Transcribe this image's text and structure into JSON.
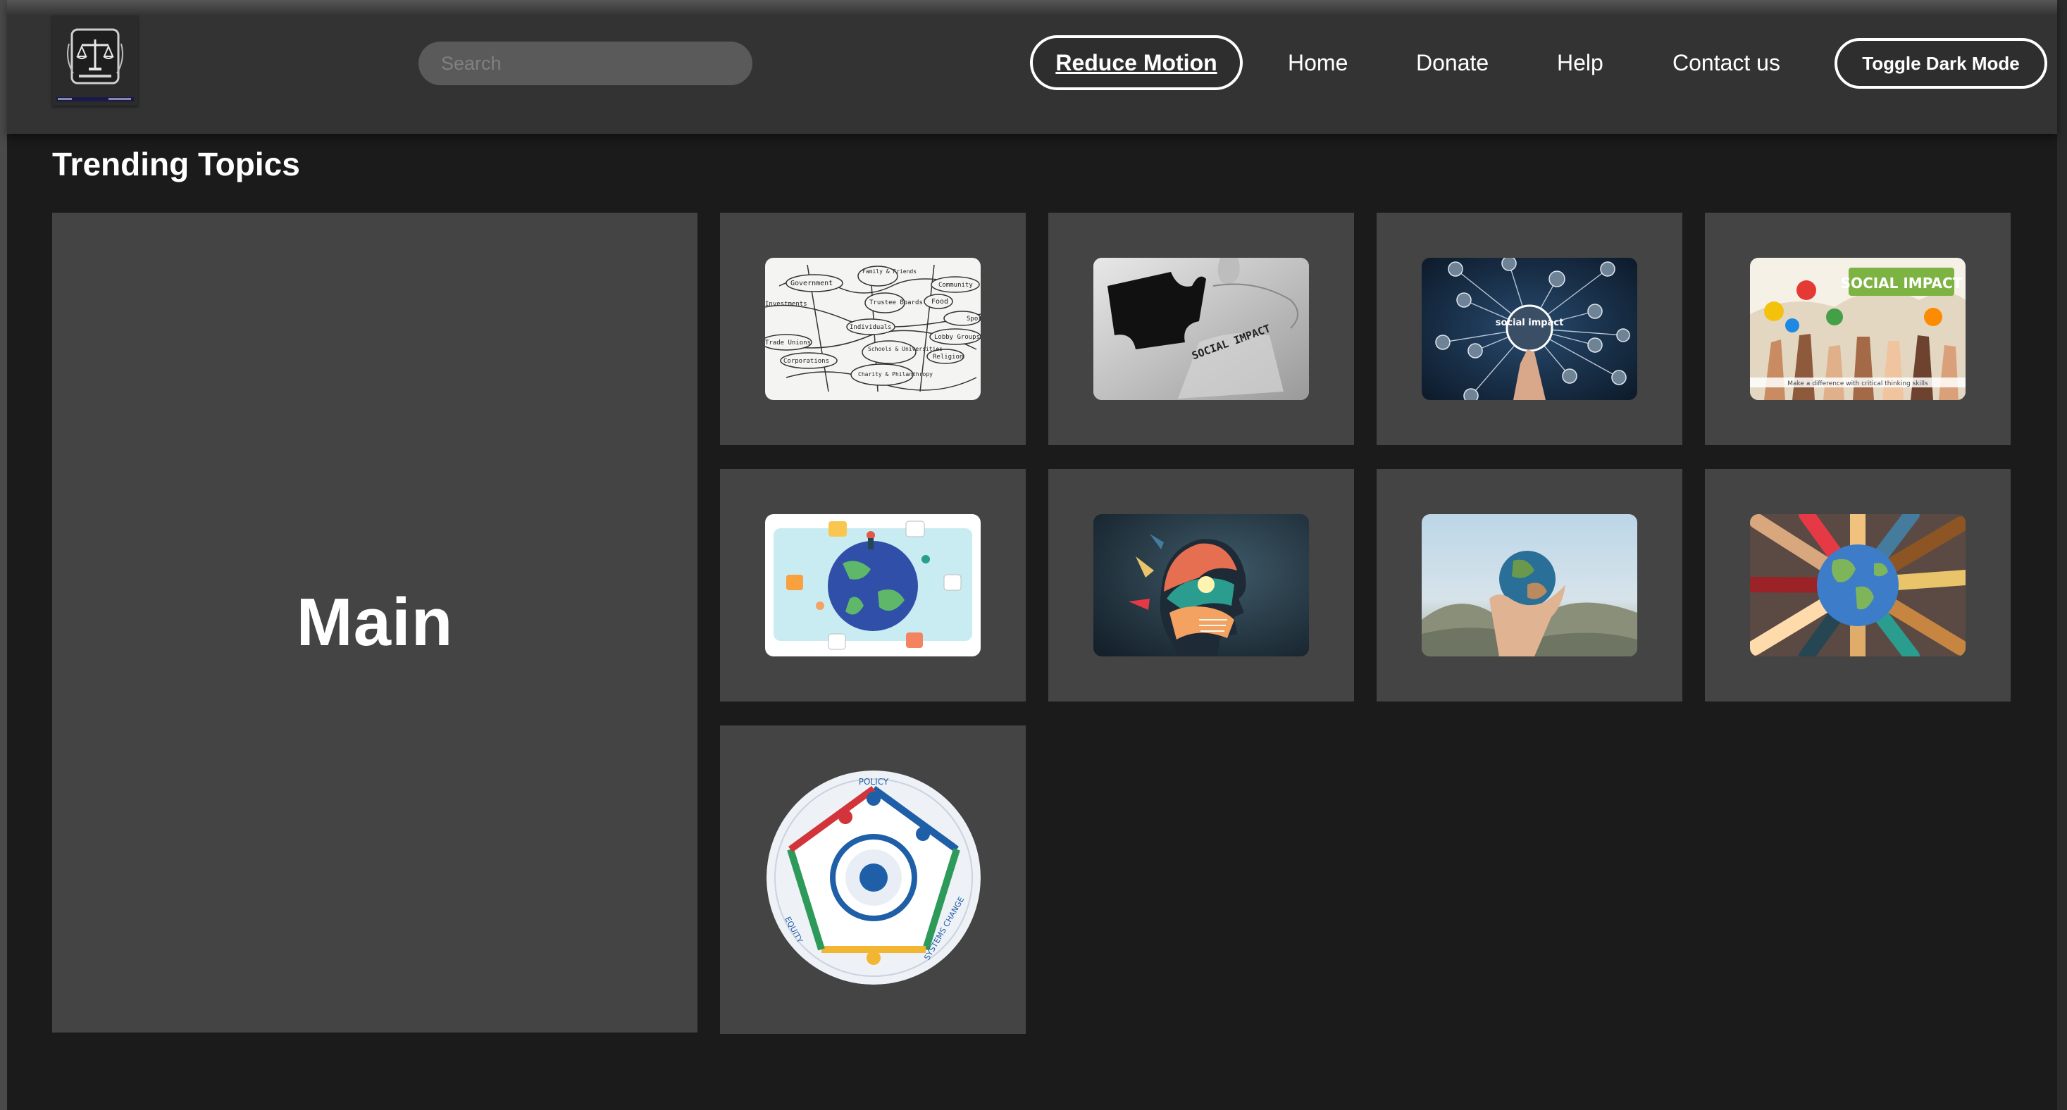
{
  "header": {
    "search": {
      "placeholder": "Search",
      "value": ""
    },
    "reduce_motion_label": "Reduce Motion",
    "nav": [
      {
        "label": "Home"
      },
      {
        "label": "Donate"
      },
      {
        "label": "Help"
      },
      {
        "label": "Contact us"
      }
    ],
    "toggle_dark_mode_label": "Toggle Dark Mode",
    "logo": {
      "icon": "scales-of-justice-emblem"
    }
  },
  "content": {
    "section_title": "Trending Topics",
    "main_label": "Main",
    "topics": [
      {
        "image": "mind-map-sketch",
        "text": [
          "Government",
          "Family & Friends",
          "Community",
          "Trustee Boards",
          "Food",
          "Investments",
          "Individuals",
          "Sport",
          "Trade Unions",
          "Lobby Groups",
          "Schools & Universities",
          "Religion",
          "Corporations",
          "Charity & Philanthropy"
        ]
      },
      {
        "image": "puzzle-pieces",
        "text": [
          "SOCIAL IMPACT"
        ]
      },
      {
        "image": "social-impact-network",
        "text": [
          "social impact"
        ]
      },
      {
        "image": "social-impact-hands-banner",
        "text": [
          "SOCIAL IMPACT",
          "Make a difference with critical thinking skills"
        ]
      },
      {
        "image": "globe-people-illustration",
        "text": []
      },
      {
        "image": "colorful-head-lightbulb",
        "text": []
      },
      {
        "image": "hand-holding-earth",
        "text": []
      },
      {
        "image": "hands-around-globe",
        "text": []
      },
      {
        "image": "policy-equity-systems-change-wheel",
        "text": [
          "POLICY",
          "EQUITY",
          "SYSTEMS CHANGE"
        ]
      }
    ]
  },
  "colors": {
    "page_background": "#1b1b1b",
    "header_background": "#333333",
    "panel_background": "#444444",
    "search_background": "#5a5a5a",
    "text": "#ffffff"
  }
}
